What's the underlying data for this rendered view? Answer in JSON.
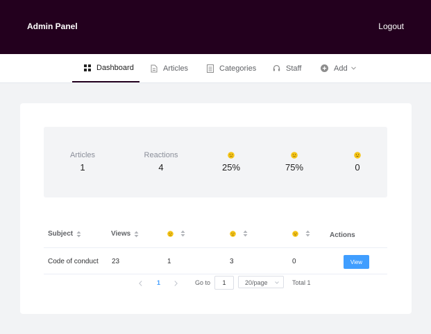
{
  "header": {
    "brand": "Admin Panel",
    "logout": "Logout"
  },
  "nav": [
    {
      "label": "Dashboard",
      "icon": "grid-icon",
      "active": true
    },
    {
      "label": "Articles",
      "icon": "document-icon"
    },
    {
      "label": "Categories",
      "icon": "list-icon"
    },
    {
      "label": "Staff",
      "icon": "headset-icon"
    },
    {
      "label": "Add",
      "icon": "plus-circle-icon"
    }
  ],
  "stats": {
    "articles": {
      "label": "Articles",
      "value": "1"
    },
    "reactions": {
      "label": "Reactions",
      "value": "4"
    },
    "sad": {
      "icon": "sad-face-icon",
      "value": "25%"
    },
    "neutral": {
      "icon": "neutral-face-icon",
      "value": "75%"
    },
    "happy": {
      "icon": "happy-face-icon",
      "value": "0"
    }
  },
  "table": {
    "headers": {
      "subject": "Subject",
      "views": "Views",
      "actions": "Actions"
    },
    "rows": [
      {
        "subject": "Code of conduct",
        "views": "23",
        "sad": "1",
        "neutral": "3",
        "happy": "0",
        "action": "View"
      }
    ]
  },
  "pagination": {
    "current": "1",
    "goto_label": "Go to",
    "goto_value": "1",
    "page_size": "20/page",
    "total": "Total 1"
  },
  "colors": {
    "header_bg": "#23001e",
    "primary": "#409eff",
    "emoji": "#f5c518"
  }
}
